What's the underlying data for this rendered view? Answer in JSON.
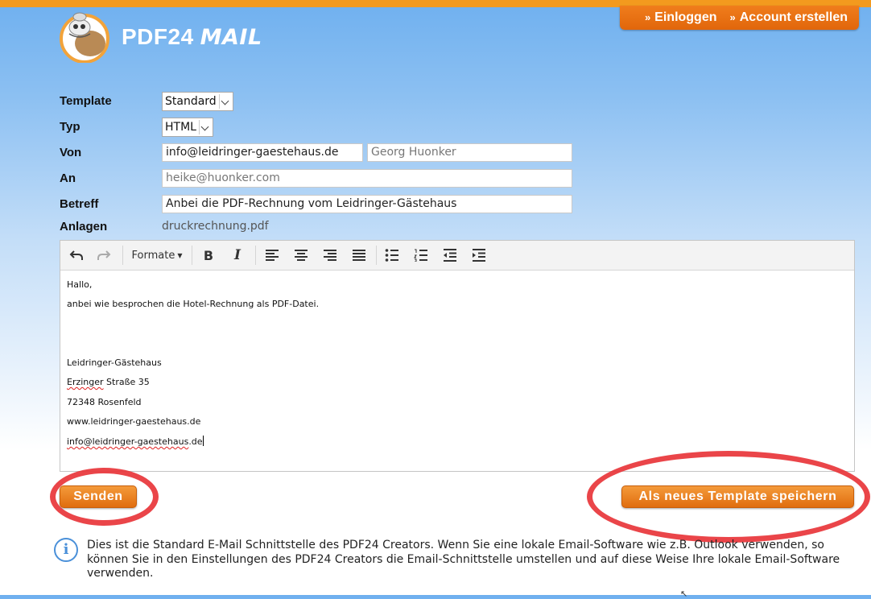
{
  "header": {
    "login_label": "Einloggen",
    "create_account_label": "Account erstellen",
    "brand_name": "PDF24",
    "brand_product": "MAIL"
  },
  "form": {
    "template": {
      "label": "Template",
      "value": "Standard"
    },
    "type": {
      "label": "Typ",
      "value": "HTML"
    },
    "from": {
      "label": "Von",
      "email": "info@leidringer-gaestehaus.de",
      "name": "Georg Huonker"
    },
    "to": {
      "label": "An",
      "value": "heike@huonker.com"
    },
    "subject": {
      "label": "Betreff",
      "value": "Anbei die PDF-Rechnung vom Leidringer-Gästehaus"
    },
    "attachments": {
      "label": "Anlagen",
      "value": "druckrechnung.pdf"
    }
  },
  "editor": {
    "formats_label": "Formate",
    "bold_label": "B",
    "italic_label": "I",
    "lines": [
      "Hallo,",
      "anbei wie besprochen die Hotel-Rechnung als PDF-Datei.",
      "Leidringer-Gästehaus",
      "Erzinger",
      " Straße 35",
      "72348 Rosenfeld",
      "www.leidringer-gaestehaus.de",
      "info@leidringer-gaestehaus",
      ".de"
    ]
  },
  "buttons": {
    "send_label": "Senden",
    "save_template_label": "Als neues Template speichern"
  },
  "info": {
    "text": "Dies ist die Standard E-Mail Schnittstelle des PDF24 Creators. Wenn Sie eine lokale Email-Software wie z.B. Outlook verwenden, so können Sie in den Einstellungen des PDF24 Creators die Email-Schnittstelle umstellen und auf diese Weise Ihre lokale Email-Software verwenden."
  },
  "colors": {
    "accent_orange": "#e8721a",
    "highlight_ring": "#e8353a",
    "info_blue": "#4a90d9"
  }
}
